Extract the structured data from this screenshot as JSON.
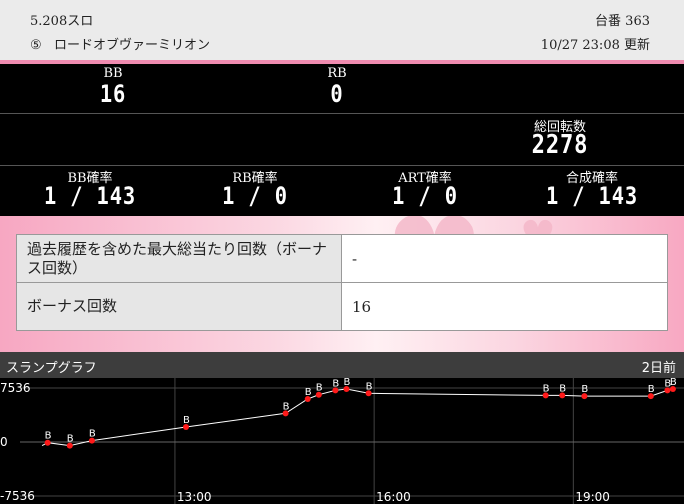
{
  "header": {
    "rate": "5.208スロ",
    "machine_number": "⑤",
    "machine_name": "ロードオブヴァーミリオン",
    "unit_label": "台番 363",
    "updated": "10/27 23:08 更新"
  },
  "stats": {
    "bb_label": "BB",
    "bb_value": "16",
    "rb_label": "RB",
    "rb_value": "0",
    "total_spins_label": "総回転数",
    "total_spins_value": "2278",
    "bb_prob_label": "BB確率",
    "bb_prob_value": "1 / 143",
    "rb_prob_label": "RB確率",
    "rb_prob_value": "1 / 0",
    "art_prob_label": "ART確率",
    "art_prob_value": "1 / 0",
    "combined_prob_label": "合成確率",
    "combined_prob_value": "1 / 143"
  },
  "info_table": {
    "rows": [
      {
        "label": "過去履歴を含めた最大総当たり回数（ボーナス回数）",
        "value": "-"
      },
      {
        "label": "ボーナス回数",
        "value": "16"
      }
    ]
  },
  "graph": {
    "title": "スランプグラフ",
    "day_selector": "2日前",
    "colors": {
      "line": "#ffffff",
      "marker": "#ff1a1a",
      "grid": "#444444",
      "zero": "#666666"
    }
  },
  "chart_data": {
    "type": "line",
    "title": "スランプグラフ",
    "yticks": [
      "7536",
      "0",
      "-7536"
    ],
    "ylim": [
      -7536,
      7536
    ],
    "xticks": [
      "13:00",
      "16:00",
      "19:00"
    ],
    "xtick_minutes": [
      780,
      960,
      1140
    ],
    "xlim": [
      640,
      1240
    ],
    "marker_label": "B",
    "series": [
      {
        "x": [
          660,
          665,
          685,
          705,
          790,
          880,
          900,
          910,
          925,
          935,
          955,
          1115,
          1130,
          1150,
          1170,
          1210,
          1225,
          1230
        ],
        "y": [
          -500,
          -100,
          -500,
          200,
          2100,
          4000,
          6000,
          6600,
          7200,
          7400,
          6800,
          6500,
          6500,
          6400,
          6400,
          6400,
          7200,
          7400
        ],
        "bonus": [
          false,
          true,
          true,
          true,
          true,
          true,
          true,
          true,
          true,
          true,
          true,
          true,
          true,
          true,
          false,
          true,
          true,
          true
        ]
      }
    ]
  }
}
